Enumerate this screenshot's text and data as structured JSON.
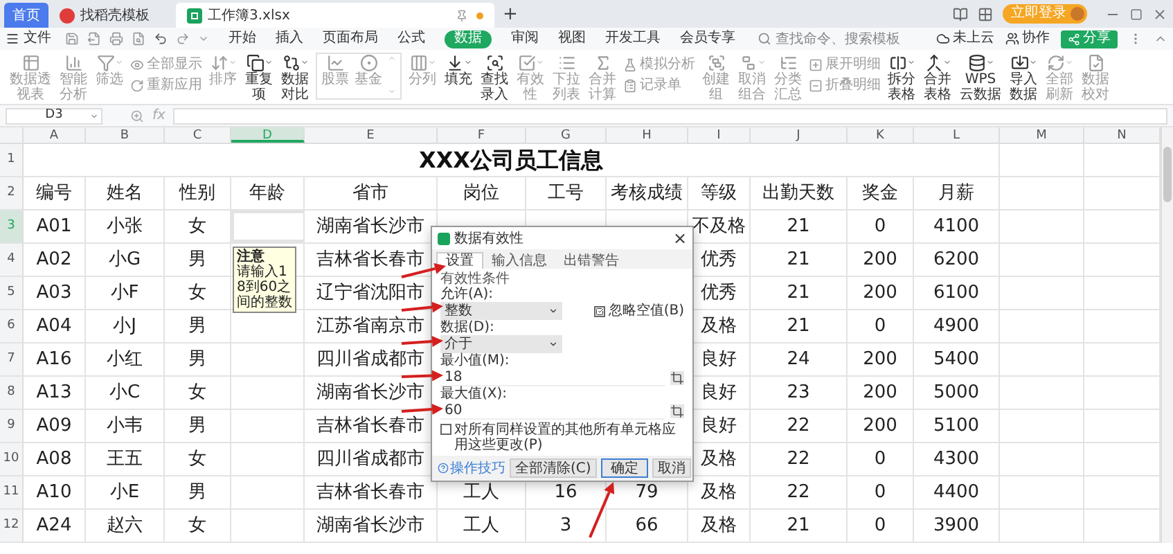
{
  "title_bar": {
    "tabs": [
      {
        "label": "首页",
        "kind": "home",
        "selected": false
      },
      {
        "label": "找稻壳模板",
        "kind": "template",
        "selected": false
      },
      {
        "label": "工作簿3.xlsx",
        "kind": "file",
        "selected": true
      }
    ],
    "new_tab": "+",
    "login": "立即登录"
  },
  "menu": {
    "file": "文件",
    "items": [
      {
        "label": "开始",
        "selected": false
      },
      {
        "label": "插入",
        "selected": false
      },
      {
        "label": "页面布局",
        "selected": false
      },
      {
        "label": "公式",
        "selected": false
      },
      {
        "label": "数据",
        "selected": true
      },
      {
        "label": "审阅",
        "selected": false
      },
      {
        "label": "视图",
        "selected": false
      },
      {
        "label": "开发工具",
        "selected": false
      },
      {
        "label": "会员专享",
        "selected": false
      }
    ],
    "search": {
      "placeholder": "查找命令、搜索模板"
    },
    "cloud": "未上云",
    "collab": "协作",
    "share": "分享"
  },
  "ribbon": [
    {
      "kind": "big",
      "label": "数据透视表",
      "dropdown": false,
      "disabled": true
    },
    {
      "kind": "big",
      "label": "智能分析",
      "dropdown": false,
      "disabled": true
    },
    {
      "kind": "big",
      "label": "筛选",
      "dropdown": true,
      "disabled": true
    },
    {
      "kind": "stack",
      "items": [
        {
          "label": "全部显示",
          "disabled": true
        },
        {
          "label": "重新应用",
          "disabled": true
        }
      ]
    },
    {
      "kind": "big",
      "label": "排序",
      "dropdown": true,
      "disabled": true
    },
    {
      "kind": "big",
      "label": "重复项",
      "dropdown": true,
      "disabled": false
    },
    {
      "kind": "big",
      "label": "数据对比",
      "dropdown": true,
      "disabled": false
    },
    {
      "kind": "panel",
      "items": [
        {
          "label": "股票",
          "disabled": true
        },
        {
          "label": "基金",
          "disabled": true
        }
      ]
    },
    {
      "kind": "big",
      "label": "分列",
      "dropdown": true,
      "disabled": true
    },
    {
      "kind": "big",
      "label": "填充",
      "dropdown": true,
      "disabled": false
    },
    {
      "kind": "big",
      "label": "查找录入",
      "dropdown": false,
      "disabled": false
    },
    {
      "kind": "big",
      "label": "有效性",
      "dropdown": true,
      "disabled": true
    },
    {
      "kind": "big",
      "label": "下拉列表",
      "dropdown": false,
      "disabled": true
    },
    {
      "kind": "big",
      "label": "合并计算",
      "dropdown": false,
      "disabled": true
    },
    {
      "kind": "stack",
      "items": [
        {
          "label": "模拟分析",
          "disabled": true
        },
        {
          "label": "记录单",
          "disabled": true
        }
      ]
    },
    {
      "kind": "big",
      "label": "创建组",
      "dropdown": false,
      "disabled": true
    },
    {
      "kind": "big",
      "label": "取消组合",
      "dropdown": true,
      "disabled": true
    },
    {
      "kind": "big",
      "label": "分类汇总",
      "dropdown": false,
      "disabled": true
    },
    {
      "kind": "stack",
      "items": [
        {
          "label": "展开明细",
          "disabled": true
        },
        {
          "label": "折叠明细",
          "disabled": true
        }
      ]
    },
    {
      "kind": "big",
      "label": "拆分表格",
      "dropdown": true,
      "disabled": false
    },
    {
      "kind": "big",
      "label": "合并表格",
      "dropdown": true,
      "disabled": false
    },
    {
      "kind": "big",
      "label": "WPS云数据",
      "dropdown": true,
      "disabled": false
    },
    {
      "kind": "big",
      "label": "导入数据",
      "dropdown": true,
      "disabled": false
    },
    {
      "kind": "big",
      "label": "全部刷新",
      "dropdown": true,
      "disabled": true
    },
    {
      "kind": "big",
      "label": "数据校对",
      "dropdown": false,
      "disabled": true
    }
  ],
  "formula_bar": {
    "name_box": "D3",
    "fx": "fx"
  },
  "sheet": {
    "columns": [
      {
        "label": "A",
        "selected": false
      },
      {
        "label": "B",
        "selected": false
      },
      {
        "label": "C",
        "selected": false
      },
      {
        "label": "D",
        "selected": true
      },
      {
        "label": "E",
        "selected": false
      },
      {
        "label": "F",
        "selected": false
      },
      {
        "label": "G",
        "selected": false
      },
      {
        "label": "H",
        "selected": false
      },
      {
        "label": "I",
        "selected": false
      },
      {
        "label": "J",
        "selected": false
      },
      {
        "label": "K",
        "selected": false
      },
      {
        "label": "L",
        "selected": false
      },
      {
        "label": "M",
        "selected": false
      },
      {
        "label": "N",
        "selected": false
      }
    ],
    "rows": [
      {
        "number": "1",
        "selected": false,
        "kind": "title",
        "text": "XXX公司员工信息"
      },
      {
        "number": "2",
        "selected": false,
        "kind": "data",
        "cells": [
          "编号",
          "姓名",
          "性别",
          "年龄",
          "省市",
          "岗位",
          "工号",
          "考核成绩",
          "等级",
          "出勤天数",
          "奖金",
          "月薪"
        ]
      },
      {
        "number": "3",
        "selected": true,
        "kind": "data",
        "cells": [
          "A01",
          "小张",
          "女",
          null,
          "湖南省长沙市",
          null,
          null,
          null,
          "不及格",
          "21",
          "0",
          "4100"
        ]
      },
      {
        "number": "4",
        "selected": false,
        "kind": "data",
        "cells": [
          "A02",
          "小G",
          "男",
          null,
          "吉林省长春市",
          null,
          null,
          null,
          "优秀",
          "21",
          "200",
          "6200"
        ]
      },
      {
        "number": "5",
        "selected": false,
        "kind": "data",
        "cells": [
          "A03",
          "小F",
          "女",
          null,
          "辽宁省沈阳市",
          null,
          null,
          null,
          "优秀",
          "21",
          "200",
          "6100"
        ]
      },
      {
        "number": "6",
        "selected": false,
        "kind": "data",
        "cells": [
          "A04",
          "小J",
          "男",
          null,
          "江苏省南京市",
          null,
          null,
          null,
          "及格",
          "21",
          "0",
          "4900"
        ]
      },
      {
        "number": "7",
        "selected": false,
        "kind": "data",
        "cells": [
          "A16",
          "小红",
          "男",
          null,
          "四川省成都市",
          null,
          null,
          null,
          "良好",
          "24",
          "200",
          "5400"
        ]
      },
      {
        "number": "8",
        "selected": false,
        "kind": "data",
        "cells": [
          "A13",
          "小C",
          "女",
          null,
          "湖南省长沙市",
          null,
          null,
          null,
          "良好",
          "23",
          "200",
          "5000"
        ]
      },
      {
        "number": "9",
        "selected": false,
        "kind": "data",
        "cells": [
          "A09",
          "小韦",
          "男",
          null,
          "吉林省长春市",
          null,
          null,
          null,
          "良好",
          "22",
          "200",
          "5100"
        ]
      },
      {
        "number": "10",
        "selected": false,
        "kind": "data",
        "cells": [
          "A08",
          "王五",
          "女",
          null,
          "四川省成都市",
          null,
          null,
          null,
          "及格",
          "22",
          "0",
          "4300"
        ]
      },
      {
        "number": "11",
        "selected": false,
        "kind": "data",
        "cells": [
          "A10",
          "小E",
          "男",
          null,
          "吉林省长春市",
          "工人",
          "16",
          "79",
          "及格",
          "22",
          "0",
          "4400"
        ]
      },
      {
        "number": "12",
        "selected": false,
        "kind": "data",
        "cells": [
          "A24",
          "赵六",
          "女",
          null,
          "湖南省长沙市",
          "工人",
          "3",
          "66",
          "及格",
          "21",
          "0",
          "3900"
        ]
      }
    ],
    "tooltip": {
      "title": "注意",
      "text": "请输入18到60之间的整数"
    }
  },
  "dialog": {
    "title": "数据有效性",
    "close": "×",
    "tabs": [
      {
        "label": "设置",
        "selected": true
      },
      {
        "label": "输入信息",
        "selected": false
      },
      {
        "label": "出错警告",
        "selected": false
      }
    ],
    "group": "有效性条件",
    "allow": {
      "label": "允许(A):",
      "value": "整数"
    },
    "ignore_blank": {
      "label": "忽略空值(B)",
      "checked": true
    },
    "data": {
      "label": "数据(D):",
      "value": "介于"
    },
    "min": {
      "label": "最小值(M):",
      "value": "18"
    },
    "max": {
      "label": "最大值(X):",
      "value": "60"
    },
    "apply_all": {
      "label": "对所有同样设置的其他所有单元格应用这些更改(P)",
      "checked": false
    },
    "tips": "操作技巧",
    "buttons": [
      {
        "label": "全部清除(C)",
        "kind": "normal"
      },
      {
        "label": "确定",
        "kind": "default"
      },
      {
        "label": "取消",
        "kind": "normal"
      }
    ]
  }
}
